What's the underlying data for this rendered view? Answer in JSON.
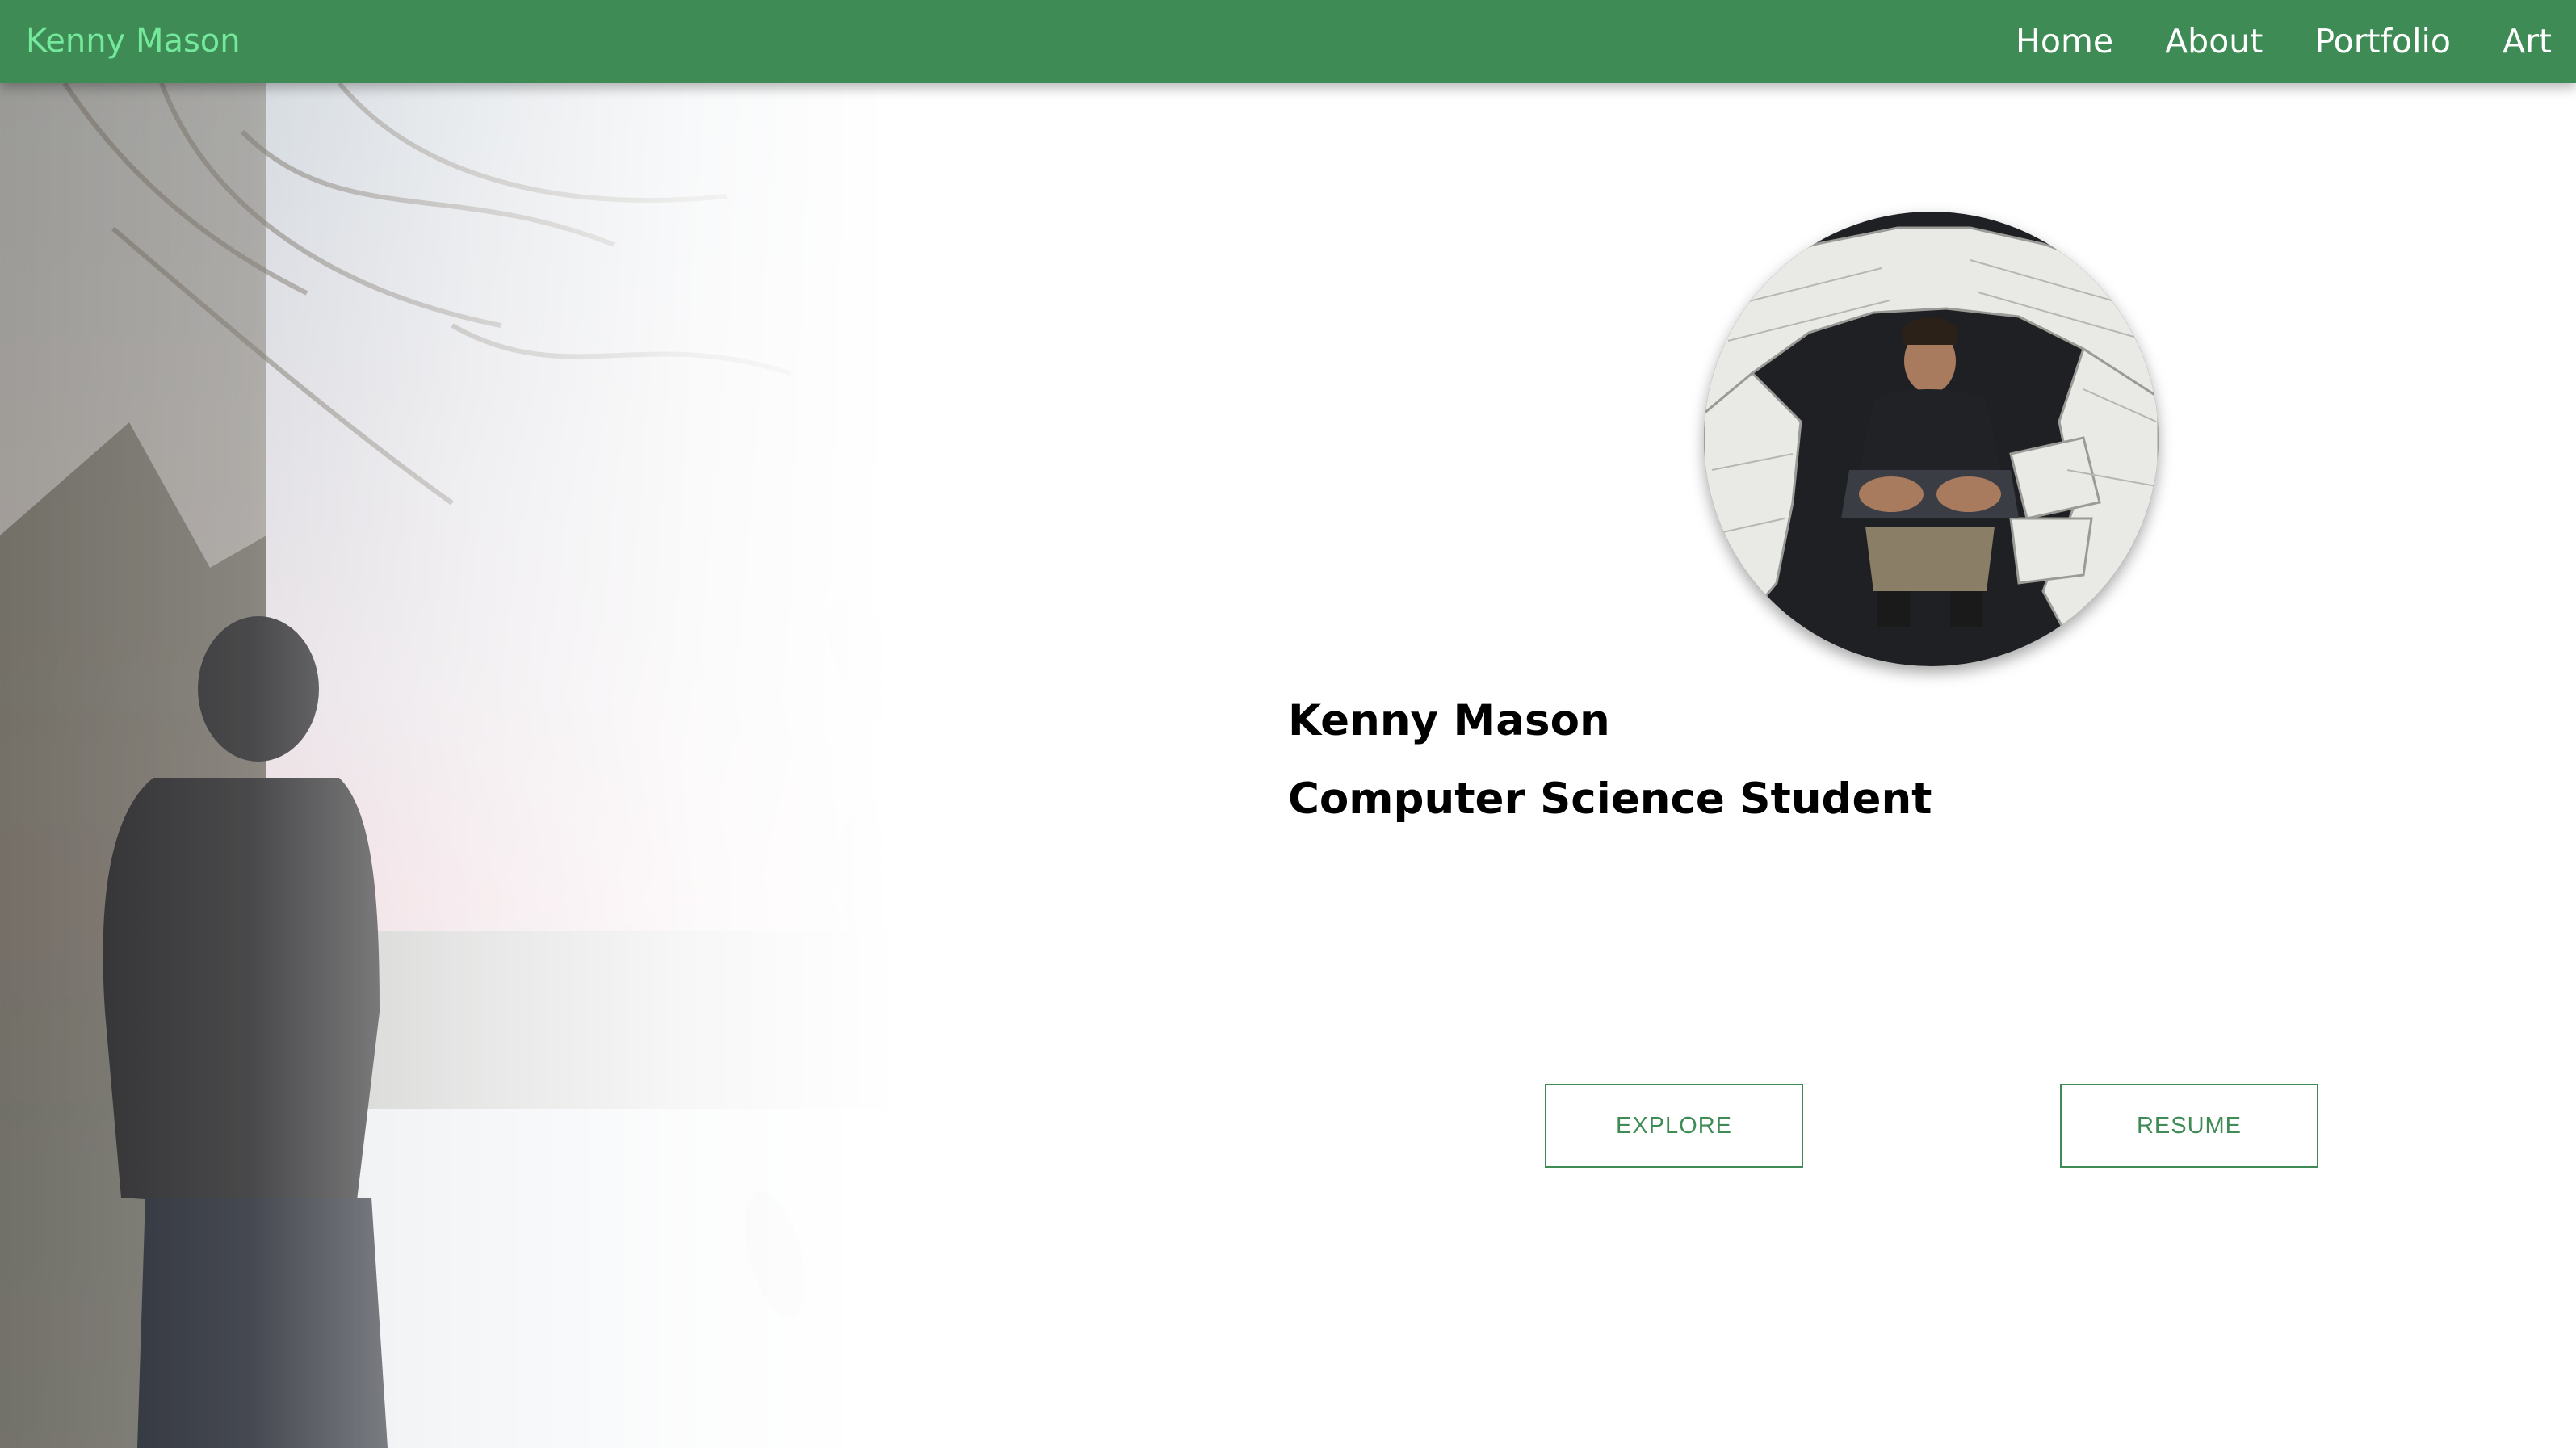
{
  "navbar": {
    "brand": "Kenny Mason",
    "links": [
      "Home",
      "About",
      "Portfolio",
      "Art"
    ]
  },
  "hero": {
    "name": "Kenny Mason",
    "title": "Computer Science Student",
    "buttons": {
      "explore": "EXPLORE",
      "resume": "RESUME"
    }
  },
  "colors": {
    "navbar_bg": "#3e8b55",
    "brand_text": "#74e89b",
    "accent": "#3e8b55"
  },
  "icons": {
    "background": "hero-background-photo",
    "avatar": "profile-photo"
  }
}
